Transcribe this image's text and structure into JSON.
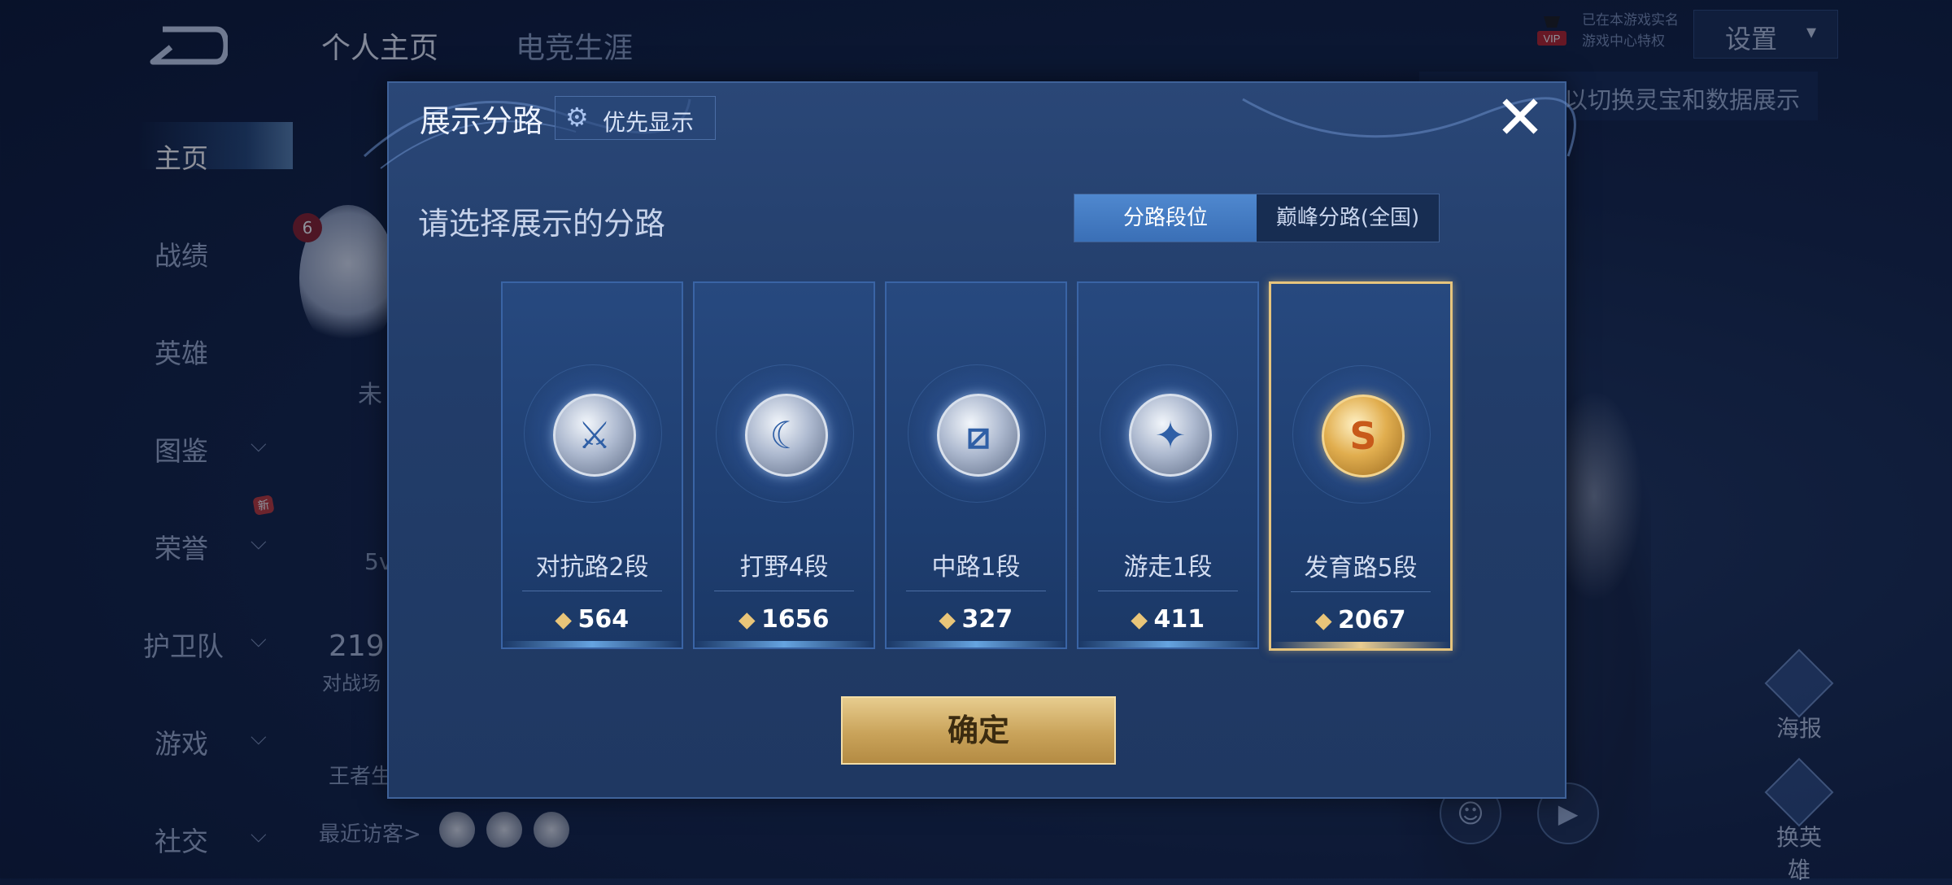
{
  "header": {
    "tabs": [
      {
        "label": "个人主页",
        "active": true
      },
      {
        "label": "电竞生涯",
        "active": false
      }
    ],
    "vip_label": "VIP",
    "vip_lines": [
      "已在本游戏实名",
      "游戏中心特权"
    ],
    "settings_label": "设置"
  },
  "sidebar": {
    "items": [
      {
        "label": "主页",
        "active": true,
        "has_chevron": false
      },
      {
        "label": "战绩",
        "active": false,
        "has_chevron": false
      },
      {
        "label": "英雄",
        "active": false,
        "has_chevron": false
      },
      {
        "label": "图鉴",
        "active": false,
        "has_chevron": true
      },
      {
        "label": "荣誉",
        "active": false,
        "has_chevron": true
      },
      {
        "label": "护卫队",
        "active": false,
        "has_chevron": true
      },
      {
        "label": "游戏",
        "active": false,
        "has_chevron": true
      },
      {
        "label": "社交",
        "active": false,
        "has_chevron": true
      }
    ],
    "new_badge": "新"
  },
  "profile": {
    "notification_count": "6",
    "partial_text_1": "未",
    "partial_text_2": "5v",
    "partial_number": "219",
    "partial_label": "对战场",
    "partial_label_2": "王者生",
    "recent_visitors_label": "最近访客>"
  },
  "tip_text": "以切换灵宝和数据展示",
  "right_buttons": [
    {
      "label": "海报"
    },
    {
      "label": "换英雄"
    }
  ],
  "modal": {
    "title": "展示分路",
    "priority_label": "优先显示",
    "prompt": "请选择展示的分路",
    "toggle": {
      "option_on": "分路段位",
      "option_off": "巅峰分路(全国)"
    },
    "cards": [
      {
        "rank": "对抗路2段",
        "points": "564",
        "selected": false,
        "icon": "sword-cross-icon"
      },
      {
        "rank": "打野4段",
        "points": "1656",
        "selected": false,
        "icon": "dragon-claw-icon"
      },
      {
        "rank": "中路1段",
        "points": "327",
        "selected": false,
        "icon": "staff-icon"
      },
      {
        "rank": "游走1段",
        "points": "411",
        "selected": false,
        "icon": "wings-icon"
      },
      {
        "rank": "发育路5段",
        "points": "2067",
        "selected": true,
        "icon": "bow-icon"
      }
    ],
    "confirm_label": "确定"
  }
}
